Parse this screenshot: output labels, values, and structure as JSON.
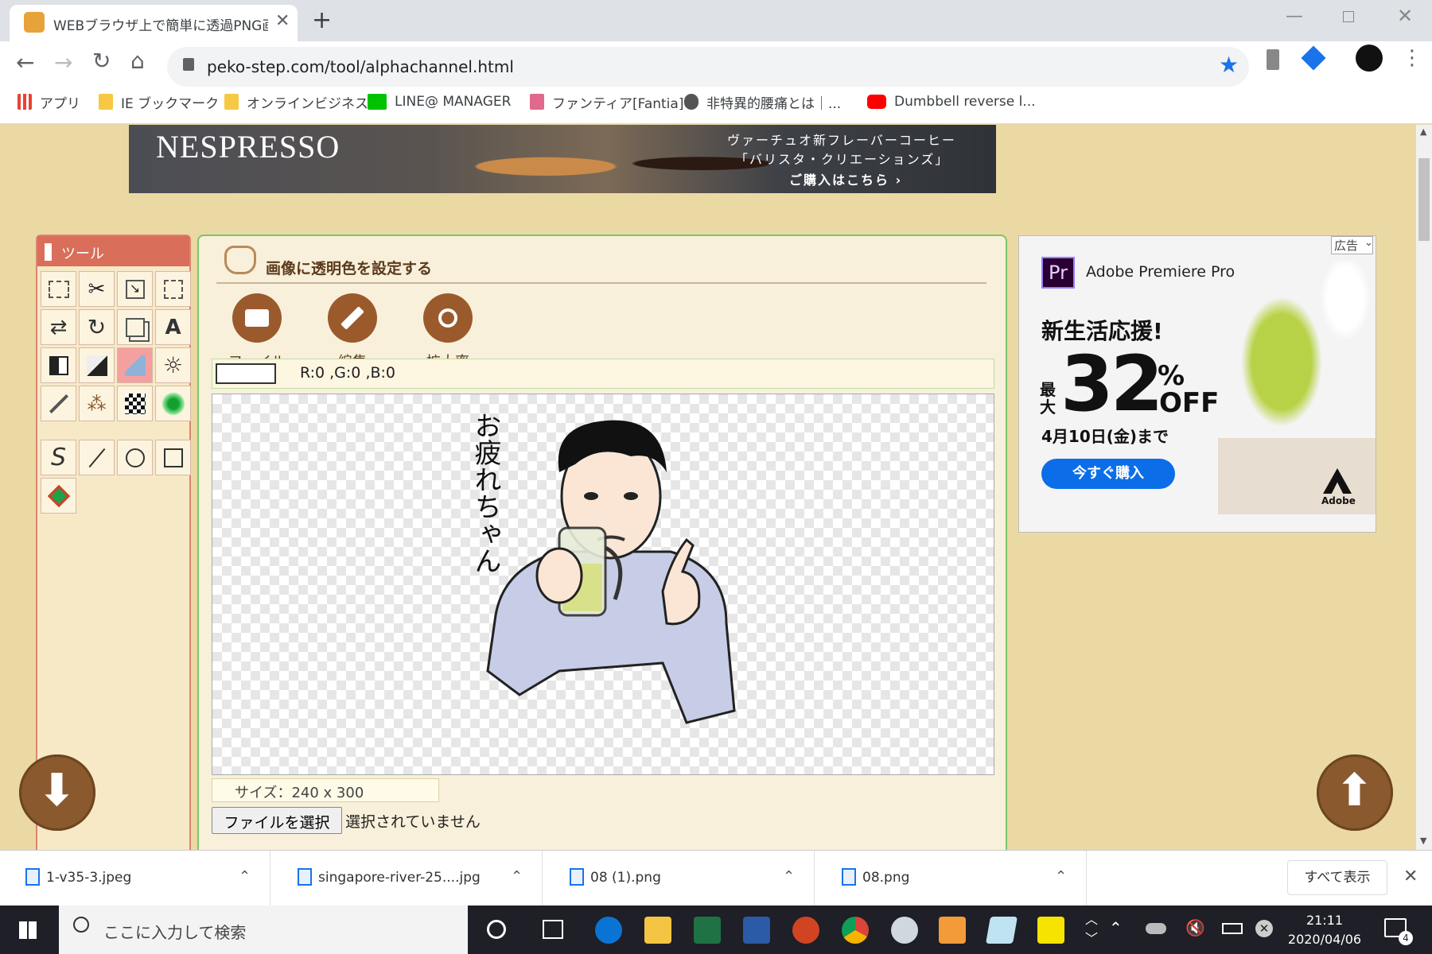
{
  "browser": {
    "tab_title": "WEBブラウザ上で簡単に透過PNG画",
    "url": "peko-step.com/tool/alphachannel.html",
    "bookmarks": [
      {
        "label": "アプリ",
        "color": "#e94235"
      },
      {
        "label": "IE ブックマーク",
        "color": "#f6c843"
      },
      {
        "label": "オンラインビジネス",
        "color": "#f6c843"
      },
      {
        "label": "LINE@ MANAGER",
        "color": "#00c300"
      },
      {
        "label": "ファンティア[Fantia]",
        "color": "#e06a8b"
      },
      {
        "label": "非特異的腰痛とは｜...",
        "color": "#555555"
      },
      {
        "label": "Dumbbell reverse l...",
        "color": "#ff0000"
      }
    ]
  },
  "banner": {
    "brand": "NESPRESSO",
    "line1": "ヴァーチュオ新フレーバーコーヒー",
    "line2": "「バリスタ・クリエーションズ」",
    "cta": "ご購入はこちら ›"
  },
  "tools": {
    "header": "ツール"
  },
  "editor": {
    "title": "画像に透明色を設定する",
    "buttons": {
      "file": "ファイル",
      "edit": "編集",
      "zoom": "拡大率"
    },
    "rgb": "R:0 ,G:0 ,B:0",
    "canvas_text": "お疲れちゃん",
    "size": "サイズ：240 x 300",
    "file_button": "ファイルを選択",
    "file_status": "選択されていません"
  },
  "ad": {
    "badge": "広告",
    "product": "Adobe Premiere Pro",
    "headline": "新生活応援!",
    "max": "最大",
    "percent": "32",
    "pct_sign": "%",
    "off": "OFF",
    "until": "4月10日(金)まで",
    "cta": "今すぐ購入",
    "brand": "Adobe"
  },
  "downloads": {
    "files": [
      "1-v35-3.jpeg",
      "singapore-river-25....jpg",
      "08 (1).png",
      "08.png"
    ],
    "show_all": "すべて表示"
  },
  "taskbar": {
    "search_placeholder": "ここに入力して検索",
    "time": "21:11",
    "date": "2020/04/06",
    "notifications": "4"
  }
}
